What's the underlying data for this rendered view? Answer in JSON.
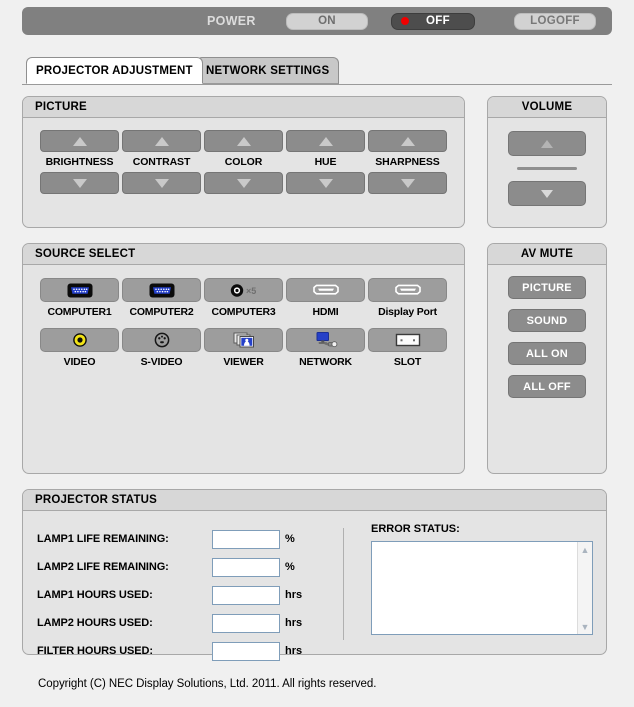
{
  "power": {
    "label": "POWER",
    "on_label": "ON",
    "off_label": "OFF",
    "logoff_label": "LOGOFF",
    "active_state": "OFF",
    "led_color": "#f00000",
    "bar_color": "#808080"
  },
  "tabs": [
    {
      "label": "PROJECTOR ADJUSTMENT",
      "active": true
    },
    {
      "label": "NETWORK SETTINGS",
      "active": false
    }
  ],
  "picture": {
    "title": "PICTURE",
    "up_icon": "triangle-up-icon",
    "down_icon": "triangle-down-icon",
    "controls": [
      {
        "label": "BRIGHTNESS"
      },
      {
        "label": "CONTRAST"
      },
      {
        "label": "COLOR"
      },
      {
        "label": "HUE"
      },
      {
        "label": "SHARPNESS"
      }
    ]
  },
  "volume": {
    "title": "VOLUME",
    "up_icon": "triangle-up-icon",
    "down_icon": "triangle-down-icon"
  },
  "source_select": {
    "title": "SOURCE SELECT",
    "row1": [
      {
        "label": "COMPUTER1",
        "icon": "vga-connector-icon"
      },
      {
        "label": "COMPUTER2",
        "icon": "vga-connector-icon"
      },
      {
        "label": "COMPUTER3",
        "icon": "bnc-x5-icon",
        "icon_text": "×5"
      },
      {
        "label": "HDMI",
        "icon": "hdmi-connector-icon"
      },
      {
        "label": "Display Port",
        "icon": "displayport-connector-icon"
      }
    ],
    "row2": [
      {
        "label": "VIDEO",
        "icon": "rca-video-jack-icon"
      },
      {
        "label": "S-VIDEO",
        "icon": "mini-din-connector-icon"
      },
      {
        "label": "VIEWER",
        "icon": "stacked-images-icon"
      },
      {
        "label": "NETWORK",
        "icon": "network-monitor-icon"
      },
      {
        "label": "SLOT",
        "icon": "expansion-card-icon"
      }
    ]
  },
  "av_mute": {
    "title": "AV MUTE",
    "buttons": [
      {
        "label": "PICTURE"
      },
      {
        "label": "SOUND"
      },
      {
        "label": "ALL ON"
      },
      {
        "label": "ALL OFF"
      }
    ]
  },
  "projector_status": {
    "title": "PROJECTOR STATUS",
    "rows": [
      {
        "label": "LAMP1 LIFE REMAINING:",
        "value": "",
        "unit": "%"
      },
      {
        "label": "LAMP2 LIFE REMAINING:",
        "value": "",
        "unit": "%"
      },
      {
        "label": "LAMP1 HOURS USED:",
        "value": "",
        "unit": "hrs"
      },
      {
        "label": "LAMP2 HOURS USED:",
        "value": "",
        "unit": "hrs"
      },
      {
        "label": "FILTER HOURS USED:",
        "value": "",
        "unit": "hrs"
      }
    ],
    "error_status": {
      "label": "ERROR STATUS:",
      "value": "",
      "scroll_up_icon": "chevron-up-icon",
      "scroll_down_icon": "chevron-down-icon"
    }
  },
  "footer": {
    "copyright": "Copyright (C) NEC Display Solutions, Ltd. 2011. All rights reserved."
  }
}
